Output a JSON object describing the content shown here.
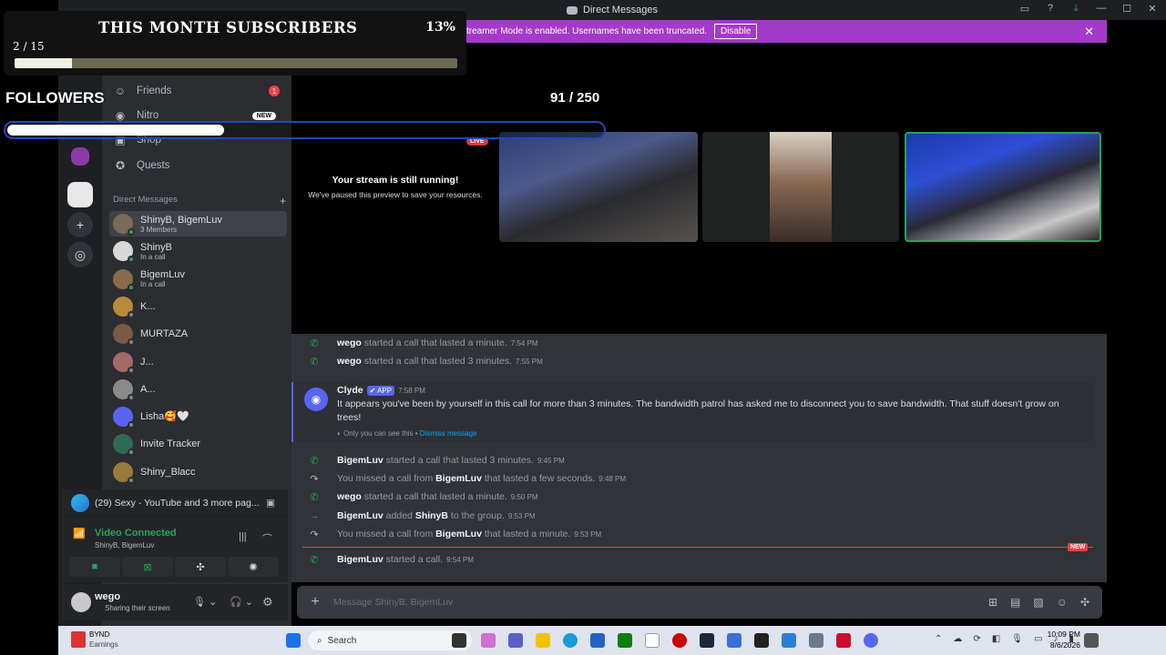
{
  "window": {
    "title": "Direct Messages"
  },
  "streamer_banner": {
    "text": "treamer Mode is enabled. Usernames have been truncated.",
    "button": "Disable"
  },
  "overlay": {
    "sub_title": "THIS MONTH SUBSCRIBERS",
    "sub_count": "2 / 15",
    "sub_percent": "13%",
    "sub_progress": 0.13,
    "followers_label": "FOLLOWERS",
    "followers_count": "91 / 250",
    "followers_progress": 0.364
  },
  "nav": {
    "friends": "Friends",
    "friends_badge": "1",
    "nitro": "Nitro",
    "nitro_badge": "NEW",
    "shop": "Shop",
    "quests": "Quests"
  },
  "dm_header": "Direct Messages",
  "dms": [
    {
      "name": "ShinyB, BigemLuv",
      "sub": "3 Members",
      "color": "#7a6a58",
      "selected": true,
      "status": "online"
    },
    {
      "name": "ShinyB",
      "sub": "In a call",
      "color": "#d8d8d8",
      "status": "online"
    },
    {
      "name": "BigemLuv",
      "sub": "In a call",
      "color": "#8a6a4a",
      "status": "online"
    },
    {
      "name": "K...",
      "sub": "",
      "color": "#b88a3a",
      "status": "offline"
    },
    {
      "name": "MURTAZA",
      "sub": "",
      "color": "#7a5a44",
      "status": "offline"
    },
    {
      "name": "J...",
      "sub": "",
      "color": "#a36a6a",
      "status": "offline"
    },
    {
      "name": "A...",
      "sub": "",
      "color": "#8a8a8a",
      "status": "offline"
    },
    {
      "name": "Lisha🥰🤍",
      "sub": "",
      "color": "#5865f2",
      "status": "offline"
    },
    {
      "name": "Invite Tracker",
      "sub": "",
      "color": "#2f6a55",
      "status": "offline"
    },
    {
      "name": "Shiny_Blacc",
      "sub": "",
      "color": "#9a7a3a",
      "status": "offline"
    }
  ],
  "now_playing": "(29) Sexy - YouTube and 3 more pag...",
  "voice": {
    "status": "Video Connected",
    "channel": "ShinyB, BigemLuv"
  },
  "user": {
    "name": "wego",
    "status": "Sharing their screen"
  },
  "stream": {
    "live": "LIVE",
    "title": "Your stream is still running!",
    "subtitle": "We've paused this preview to save your resources."
  },
  "chat": [
    {
      "icon": "phone",
      "user": "wego",
      "text": " started a call that lasted a minute.",
      "time": "7:54 PM"
    },
    {
      "icon": "phone",
      "user": "wego",
      "text": " started a call that lasted 3 minutes.",
      "time": "7:55 PM"
    },
    {
      "icon": "phone",
      "user": "BigemLuv",
      "text": " started a call that lasted 3 minutes.",
      "time": "9:45 PM"
    },
    {
      "icon": "missed",
      "pre": "You missed a call from ",
      "user": "BigemLuv",
      "text": " that lasted a few seconds.",
      "time": "9:48 PM"
    },
    {
      "icon": "phone",
      "user": "wego",
      "text": " started a call that lasted a minute.",
      "time": "9:50 PM"
    },
    {
      "icon": "arrow",
      "user": "BigemLuv",
      "text": " added ",
      "user2": "ShinyB",
      "text2": " to the group.",
      "time": "9:53 PM"
    },
    {
      "icon": "missed",
      "pre": "You missed a call from ",
      "user": "BigemLuv",
      "text": " that lasted a minute.",
      "time": "9:53 PM"
    },
    {
      "icon": "phone",
      "user": "BigemLuv",
      "text": " started a call.",
      "time": "9:54 PM"
    }
  ],
  "clyde": {
    "name": "Clyde",
    "tag": "✔ APP",
    "time": "7:58 PM",
    "text": "It appears you've been by yourself in this call for more than 3 minutes. The bandwidth patrol has asked me to disconnect you to save bandwidth. That stuff doesn't grow on trees!",
    "note": "Only you can see this • ",
    "dismiss": "Dismiss message"
  },
  "new_divider": "NEW",
  "composer": {
    "placeholder": "Message ShinyB, BigemLuv"
  },
  "taskbar": {
    "widget_title": "BYND",
    "widget_sub": "Earnings",
    "search": "Search",
    "time": "10:09 PM",
    "date": "8/6/2026"
  },
  "colors": {
    "accent": "#5865f2",
    "online": "#23a55a",
    "banner": "#a33ac9",
    "red": "#f23f43"
  }
}
